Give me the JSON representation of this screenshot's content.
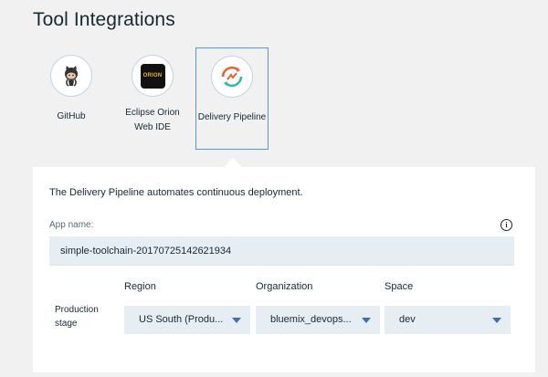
{
  "page": {
    "title": "Tool Integrations"
  },
  "tools": [
    {
      "label": "GitHub",
      "icon": "github-icon"
    },
    {
      "label": "Eclipse Orion Web IDE",
      "icon": "orion-icon",
      "icon_text": "ORION"
    },
    {
      "label": "Delivery Pipeline",
      "icon": "delivery-pipeline-icon",
      "selected": true
    }
  ],
  "panel": {
    "description": "The Delivery Pipeline automates continuous deployment.",
    "app_name": {
      "label": "App name:",
      "value": "simple-toolchain-20170725142621934"
    },
    "columns": {
      "region": "Region",
      "organization": "Organization",
      "space": "Space"
    },
    "stage": {
      "label": "Production stage",
      "region": "US South (Produ...",
      "organization": "bluemix_devops...",
      "space": "dev"
    }
  },
  "colors": {
    "accent": "#5596e6",
    "caret": "#3d70b2",
    "field_bg": "#e6eef4"
  }
}
